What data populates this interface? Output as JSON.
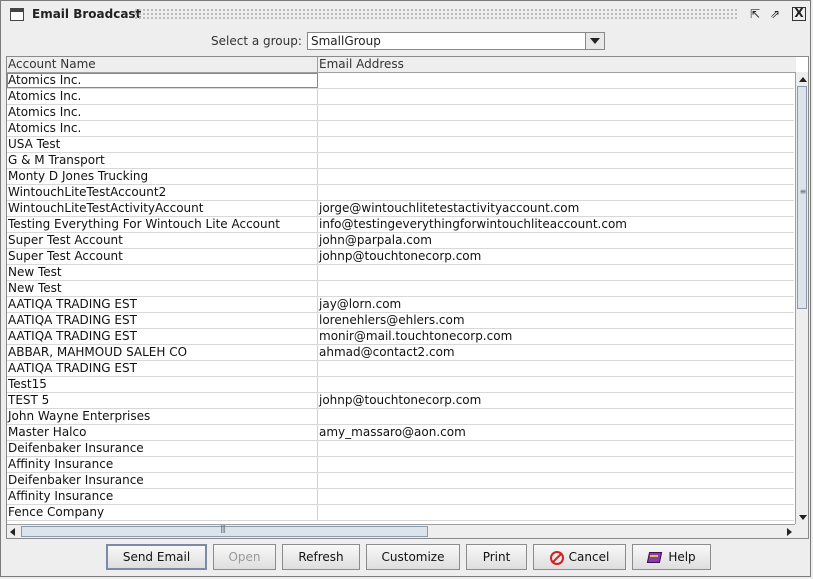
{
  "window": {
    "title": "Email Broadcast",
    "close_glyph": "X",
    "restore_glyph": "⇱",
    "maximize_glyph": "⇗"
  },
  "group": {
    "label": "Select a group:",
    "selected": "SmallGroup"
  },
  "table": {
    "columns": [
      "Account Name",
      "Email Address"
    ],
    "rows": [
      [
        "Atomics Inc.",
        ""
      ],
      [
        "Atomics Inc.",
        ""
      ],
      [
        "Atomics Inc.",
        ""
      ],
      [
        "Atomics Inc.",
        ""
      ],
      [
        "USA Test",
        ""
      ],
      [
        "G & M Transport",
        ""
      ],
      [
        "Monty D Jones Trucking",
        ""
      ],
      [
        "WintouchLiteTestAccount2",
        ""
      ],
      [
        "WintouchLiteTestActivityAccount",
        "jorge@wintouchlitetestactivityaccount.com"
      ],
      [
        "Testing Everything For Wintouch Lite Account",
        "info@testingeverythingforwintouchliteaccount.com"
      ],
      [
        "Super Test Account",
        "john@parpala.com"
      ],
      [
        "Super Test Account",
        "johnp@touchtonecorp.com"
      ],
      [
        "New Test",
        ""
      ],
      [
        "New Test",
        ""
      ],
      [
        "AATIQA TRADING EST",
        "jay@lorn.com"
      ],
      [
        "AATIQA TRADING EST",
        "lorenehlers@ehlers.com"
      ],
      [
        "AATIQA TRADING EST",
        "monir@mail.touchtonecorp.com"
      ],
      [
        "ABBAR, MAHMOUD SALEH CO",
        "ahmad@contact2.com"
      ],
      [
        "AATIQA TRADING EST",
        ""
      ],
      [
        "Test15",
        ""
      ],
      [
        "TEST 5",
        "johnp@touchtonecorp.com"
      ],
      [
        "John Wayne Enterprises",
        ""
      ],
      [
        "Master Halco",
        "amy_massaro@aon.com"
      ],
      [
        "Deifenbaker Insurance",
        ""
      ],
      [
        "Affinity Insurance",
        ""
      ],
      [
        "Deifenbaker Insurance",
        ""
      ],
      [
        "Affinity Insurance",
        ""
      ],
      [
        "Fence Company",
        ""
      ]
    ]
  },
  "buttons": {
    "send_email": "Send Email",
    "open": "Open",
    "refresh": "Refresh",
    "customize": "Customize",
    "print": "Print",
    "cancel": "Cancel",
    "help": "Help"
  }
}
